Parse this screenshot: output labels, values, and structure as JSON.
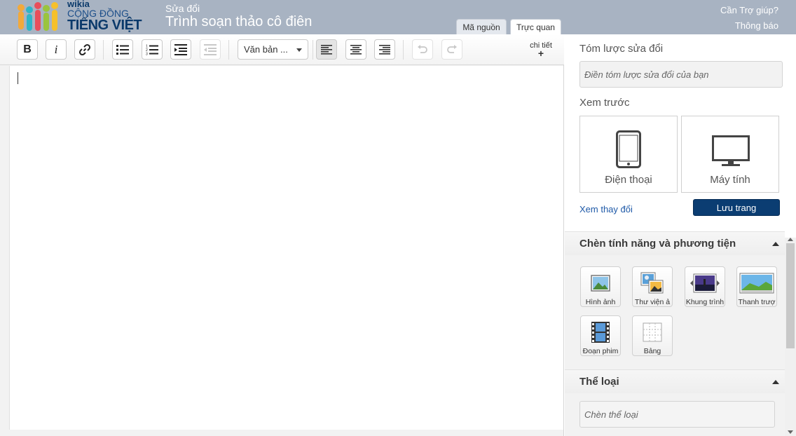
{
  "header": {
    "logo_wikia": "wikia",
    "logo_line1": "CỘNG ĐỒNG",
    "logo_line2": "TIẾNG VIỆT",
    "subtitle": "Sửa đổi",
    "title": "Trình soạn thảo cô điên",
    "tab_source": "Mã nguồn",
    "tab_visual": "Trực quan",
    "help_link": "Cần Trợ giúp?",
    "notifications_link": "Thông báo"
  },
  "toolbar": {
    "bold": "B",
    "italic": "i",
    "format_select": "Văn bản ...",
    "details_label": "chi tiết",
    "details_plus": "+"
  },
  "rail": {
    "summary_label": "Tóm lược sửa đổi",
    "summary_placeholder": "Điền tóm lược sửa đổi của bạn",
    "preview_label": "Xem trước",
    "preview_phone": "Điện thoại",
    "preview_desktop": "Máy tính",
    "view_changes": "Xem thay đổi",
    "save_button": "Lưu trang",
    "insert_section": "Chèn tính năng và phương tiện",
    "insert_tools": [
      {
        "label": "Hình ảnh",
        "icon": "image-icon"
      },
      {
        "label": "Thư viện ả",
        "icon": "gallery-icon"
      },
      {
        "label": "Khung trình",
        "icon": "slideshow-icon"
      },
      {
        "label": "Thanh trượ",
        "icon": "slider-icon"
      },
      {
        "label": "Đoạn phim",
        "icon": "video-icon"
      },
      {
        "label": "Bảng",
        "icon": "table-icon"
      }
    ],
    "category_section": "Thể loại",
    "category_placeholder": "Chèn thể loại"
  },
  "colors": {
    "header_bg": "#a8b3c2",
    "save_button_bg": "#0b3d72",
    "link": "#1f5aa8"
  }
}
